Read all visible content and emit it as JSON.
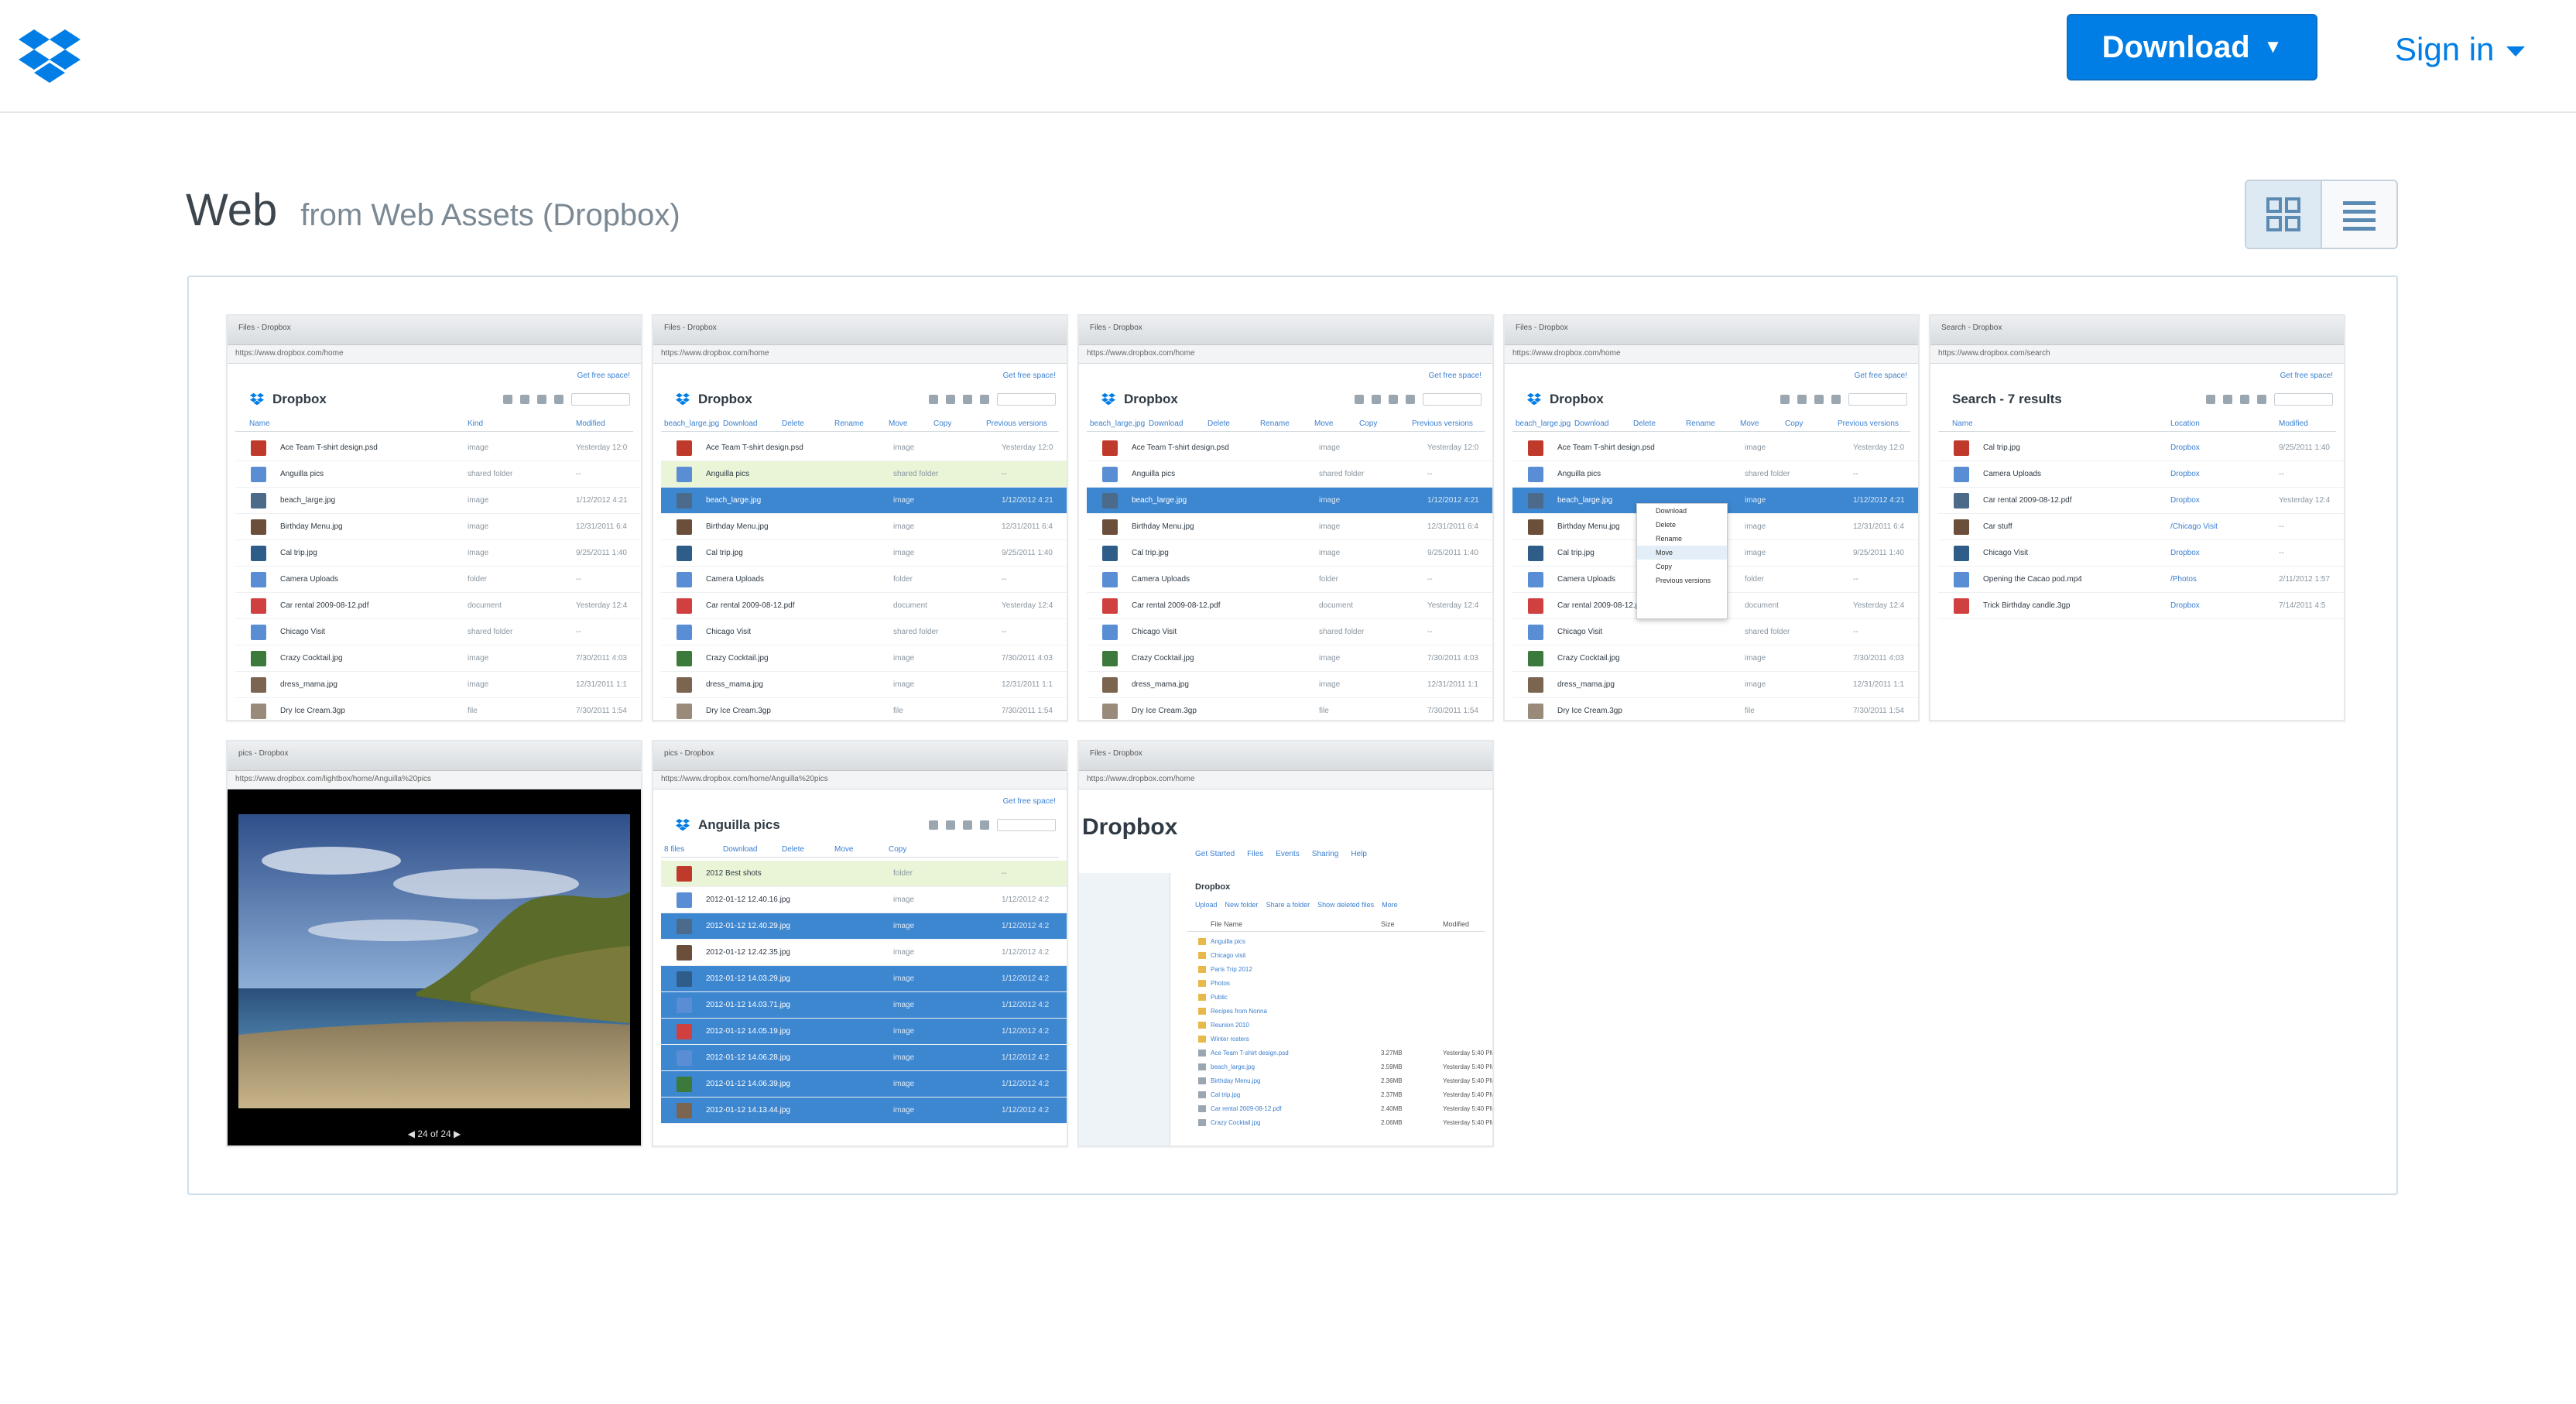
{
  "header": {
    "download_label": "Download",
    "download_caret": "▼",
    "signin_label": "Sign in",
    "brand_color": "#007ee5"
  },
  "title": {
    "main": "Web",
    "subtitle": "from Web Assets (Dropbox)"
  },
  "view_toggle": {
    "active": "grid",
    "options": [
      "grid-icon",
      "list-icon"
    ]
  },
  "thumbnails": [
    {
      "kind": "file-list",
      "tab": "Files - Dropbox",
      "url": "https://www.dropbox.com/home",
      "free": "Get free space!",
      "app_title": "Dropbox",
      "columns": [
        "Name",
        "Kind",
        "Modified"
      ],
      "rows": [
        {
          "name": "Ace Team T-shirt design.psd",
          "kind": "image",
          "modified": "Yesterday 12:0",
          "state": ""
        },
        {
          "name": "Anguilla pics",
          "kind": "shared folder",
          "modified": "--",
          "state": ""
        },
        {
          "name": "beach_large.jpg",
          "kind": "image",
          "modified": "1/12/2012 4:21",
          "state": ""
        },
        {
          "name": "Birthday Menu.jpg",
          "kind": "image",
          "modified": "12/31/2011 6:4",
          "state": ""
        },
        {
          "name": "Cal trip.jpg",
          "kind": "image",
          "modified": "9/25/2011 1:40",
          "state": ""
        },
        {
          "name": "Camera Uploads",
          "kind": "folder",
          "modified": "--",
          "state": ""
        },
        {
          "name": "Car rental 2009-08-12.pdf",
          "kind": "document",
          "modified": "Yesterday 12:4",
          "state": ""
        },
        {
          "name": "Chicago Visit",
          "kind": "shared folder",
          "modified": "--",
          "state": ""
        },
        {
          "name": "Crazy Cocktail.jpg",
          "kind": "image",
          "modified": "7/30/2011 4:03",
          "state": ""
        },
        {
          "name": "dress_mama.jpg",
          "kind": "image",
          "modified": "12/31/2011 1:1",
          "state": ""
        },
        {
          "name": "Dry Ice Cream.3gp",
          "kind": "file",
          "modified": "7/30/2011 1:54",
          "state": ""
        }
      ]
    },
    {
      "kind": "file-list",
      "tab": "Files - Dropbox",
      "url": "https://www.dropbox.com/home",
      "free": "Get free space!",
      "app_title": "Dropbox",
      "columns": [
        "beach_large.jpg",
        "Download",
        "Delete",
        "Rename",
        "Move",
        "Copy",
        "Previous versions"
      ],
      "rows": [
        {
          "name": "Ace Team T-shirt design.psd",
          "kind": "image",
          "modified": "Yesterday 12:0",
          "state": ""
        },
        {
          "name": "Anguilla pics",
          "kind": "shared folder",
          "modified": "--",
          "state": "hl"
        },
        {
          "name": "beach_large.jpg",
          "kind": "image",
          "modified": "1/12/2012 4:21",
          "state": "sel"
        },
        {
          "name": "Birthday Menu.jpg",
          "kind": "image",
          "modified": "12/31/2011 6:4",
          "state": ""
        },
        {
          "name": "Cal trip.jpg",
          "kind": "image",
          "modified": "9/25/2011 1:40",
          "state": ""
        },
        {
          "name": "Camera Uploads",
          "kind": "folder",
          "modified": "--",
          "state": ""
        },
        {
          "name": "Car rental 2009-08-12.pdf",
          "kind": "document",
          "modified": "Yesterday 12:4",
          "state": ""
        },
        {
          "name": "Chicago Visit",
          "kind": "shared folder",
          "modified": "--",
          "state": ""
        },
        {
          "name": "Crazy Cocktail.jpg",
          "kind": "image",
          "modified": "7/30/2011 4:03",
          "state": ""
        },
        {
          "name": "dress_mama.jpg",
          "kind": "image",
          "modified": "12/31/2011 1:1",
          "state": ""
        },
        {
          "name": "Dry Ice Cream.3gp",
          "kind": "file",
          "modified": "7/30/2011 1:54",
          "state": ""
        }
      ]
    },
    {
      "kind": "file-list",
      "tab": "Files - Dropbox",
      "url": "https://www.dropbox.com/home",
      "free": "Get free space!",
      "app_title": "Dropbox",
      "columns": [
        "beach_large.jpg",
        "Download",
        "Delete",
        "Rename",
        "Move",
        "Copy",
        "Previous versions"
      ],
      "rows": [
        {
          "name": "Ace Team T-shirt design.psd",
          "kind": "image",
          "modified": "Yesterday 12:0",
          "state": ""
        },
        {
          "name": "Anguilla pics",
          "kind": "shared folder",
          "modified": "--",
          "state": ""
        },
        {
          "name": "beach_large.jpg",
          "kind": "image",
          "modified": "1/12/2012 4:21",
          "state": "sel"
        },
        {
          "name": "Birthday Menu.jpg",
          "kind": "image",
          "modified": "12/31/2011 6:4",
          "state": ""
        },
        {
          "name": "Cal trip.jpg",
          "kind": "image",
          "modified": "9/25/2011 1:40",
          "state": ""
        },
        {
          "name": "Camera Uploads",
          "kind": "folder",
          "modified": "--",
          "state": ""
        },
        {
          "name": "Car rental 2009-08-12.pdf",
          "kind": "document",
          "modified": "Yesterday 12:4",
          "state": ""
        },
        {
          "name": "Chicago Visit",
          "kind": "shared folder",
          "modified": "--",
          "state": ""
        },
        {
          "name": "Crazy Cocktail.jpg",
          "kind": "image",
          "modified": "7/30/2011 4:03",
          "state": ""
        },
        {
          "name": "dress_mama.jpg",
          "kind": "image",
          "modified": "12/31/2011 1:1",
          "state": ""
        },
        {
          "name": "Dry Ice Cream.3gp",
          "kind": "file",
          "modified": "7/30/2011 1:54",
          "state": ""
        }
      ]
    },
    {
      "kind": "file-list-menu",
      "tab": "Files - Dropbox",
      "url": "https://www.dropbox.com/home",
      "free": "Get free space!",
      "app_title": "Dropbox",
      "columns": [
        "beach_large.jpg",
        "Download",
        "Delete",
        "Rename",
        "Move",
        "Copy",
        "Previous versions"
      ],
      "menu": [
        "Download",
        "Delete",
        "Rename",
        "Move",
        "Copy",
        "Previous versions"
      ],
      "rows": [
        {
          "name": "Ace Team T-shirt design.psd",
          "kind": "image",
          "modified": "Yesterday 12:0",
          "state": ""
        },
        {
          "name": "Anguilla pics",
          "kind": "shared folder",
          "modified": "--",
          "state": ""
        },
        {
          "name": "beach_large.jpg",
          "kind": "image",
          "modified": "1/12/2012 4:21",
          "state": "sel"
        },
        {
          "name": "Birthday Menu.jpg",
          "kind": "image",
          "modified": "12/31/2011 6:4",
          "state": ""
        },
        {
          "name": "Cal trip.jpg",
          "kind": "image",
          "modified": "9/25/2011 1:40",
          "state": ""
        },
        {
          "name": "Camera Uploads",
          "kind": "folder",
          "modified": "--",
          "state": ""
        },
        {
          "name": "Car rental 2009-08-12.pdf",
          "kind": "document",
          "modified": "Yesterday 12:4",
          "state": ""
        },
        {
          "name": "Chicago Visit",
          "kind": "shared folder",
          "modified": "--",
          "state": ""
        },
        {
          "name": "Crazy Cocktail.jpg",
          "kind": "image",
          "modified": "7/30/2011 4:03",
          "state": ""
        },
        {
          "name": "dress_mama.jpg",
          "kind": "image",
          "modified": "12/31/2011 1:1",
          "state": ""
        },
        {
          "name": "Dry Ice Cream.3gp",
          "kind": "file",
          "modified": "7/30/2011 1:54",
          "state": ""
        }
      ]
    },
    {
      "kind": "search",
      "tab": "Search - Dropbox",
      "url": "https://www.dropbox.com/search",
      "free": "Get free space!",
      "app_title": "Search - 7 results",
      "columns": [
        "Name",
        "Location",
        "Modified"
      ],
      "rows": [
        {
          "name": "Cal trip.jpg",
          "kind": "Dropbox",
          "modified": "9/25/2011 1:40",
          "state": ""
        },
        {
          "name": "Camera Uploads",
          "kind": "Dropbox",
          "modified": "--",
          "state": ""
        },
        {
          "name": "Car rental 2009-08-12.pdf",
          "kind": "Dropbox",
          "modified": "Yesterday 12:4",
          "state": ""
        },
        {
          "name": "Car stuff",
          "kind": "/Chicago Visit",
          "modified": "--",
          "state": ""
        },
        {
          "name": "Chicago Visit",
          "kind": "Dropbox",
          "modified": "--",
          "state": ""
        },
        {
          "name": "Opening the Cacao pod.mp4",
          "kind": "/Photos",
          "modified": "2/11/2012 1:57",
          "state": ""
        },
        {
          "name": "Trick Birthday candle.3gp",
          "kind": "Dropbox",
          "modified": "7/14/2011 4:5",
          "state": ""
        }
      ]
    },
    {
      "kind": "photo",
      "tab": "pics - Dropbox",
      "url": "https://www.dropbox.com/lightbox/home/Anguilla%20pics",
      "nav": "24 of 24"
    },
    {
      "kind": "file-list",
      "tab": "pics - Dropbox",
      "url": "https://www.dropbox.com/home/Anguilla%20pics",
      "free": "Get free space!",
      "app_title": "Anguilla pics",
      "columns": [
        "8 files",
        "Download",
        "Delete",
        "Move",
        "Copy"
      ],
      "rows": [
        {
          "name": "2012 Best shots",
          "kind": "folder",
          "modified": "--",
          "state": "hl"
        },
        {
          "name": "2012-01-12 12.40.16.jpg",
          "kind": "image",
          "modified": "1/12/2012 4:2",
          "state": ""
        },
        {
          "name": "2012-01-12 12.40.29.jpg",
          "kind": "image",
          "modified": "1/12/2012 4:2",
          "state": "sel"
        },
        {
          "name": "2012-01-12 12.42.35.jpg",
          "kind": "image",
          "modified": "1/12/2012 4:2",
          "state": ""
        },
        {
          "name": "2012-01-12 14.03.29.jpg",
          "kind": "image",
          "modified": "1/12/2012 4:2",
          "state": "sel"
        },
        {
          "name": "2012-01-12 14.03.71.jpg",
          "kind": "image",
          "modified": "1/12/2012 4:2",
          "state": "sel"
        },
        {
          "name": "2012-01-12 14.05.19.jpg",
          "kind": "image",
          "modified": "1/12/2012 4:2",
          "state": "sel"
        },
        {
          "name": "2012-01-12 14.06.28.jpg",
          "kind": "image",
          "modified": "1/12/2012 4:2",
          "state": "sel"
        },
        {
          "name": "2012-01-12 14.06.39.jpg",
          "kind": "image",
          "modified": "1/12/2012 4:2",
          "state": "sel"
        },
        {
          "name": "2012-01-12 14.13.44.jpg",
          "kind": "image",
          "modified": "1/12/2012 4:2",
          "state": "sel"
        }
      ]
    },
    {
      "kind": "old-ui",
      "tab": "Files - Dropbox",
      "url": "https://www.dropbox.com/home",
      "app_title": "Dropbox",
      "tabs": [
        "Get Started",
        "Files",
        "Events",
        "Sharing",
        "Help"
      ],
      "folder": "Dropbox",
      "actions": [
        "Upload",
        "New folder",
        "Share a folder",
        "Show deleted files",
        "More"
      ],
      "columns": [
        "File Name",
        "Size",
        "Modified"
      ],
      "rows": [
        {
          "name": "Anguilla pics",
          "size": "",
          "modified": ""
        },
        {
          "name": "Chicago visit",
          "size": "",
          "modified": ""
        },
        {
          "name": "Paris Trip 2012",
          "size": "",
          "modified": ""
        },
        {
          "name": "Photos",
          "size": "",
          "modified": ""
        },
        {
          "name": "Public",
          "size": "",
          "modified": ""
        },
        {
          "name": "Recipes from Nonna",
          "size": "",
          "modified": ""
        },
        {
          "name": "Reunion 2010",
          "size": "",
          "modified": ""
        },
        {
          "name": "Winter rosters",
          "size": "",
          "modified": ""
        },
        {
          "name": "Ace Team T-shirt design.psd",
          "size": "3.27MB",
          "modified": "Yesterday 5:40 PM"
        },
        {
          "name": "beach_large.jpg",
          "size": "2.59MB",
          "modified": "Yesterday 5:40 PM"
        },
        {
          "name": "Birthday Menu.jpg",
          "size": "2.36MB",
          "modified": "Yesterday 5:40 PM"
        },
        {
          "name": "Cal trip.jpg",
          "size": "2.37MB",
          "modified": "Yesterday 5:40 PM"
        },
        {
          "name": "Car rental 2009-08-12.pdf",
          "size": "2.40MB",
          "modified": "Yesterday 5:40 PM"
        },
        {
          "name": "Crazy Cocktail.jpg",
          "size": "2.06MB",
          "modified": "Yesterday 5:40 PM"
        }
      ]
    }
  ]
}
